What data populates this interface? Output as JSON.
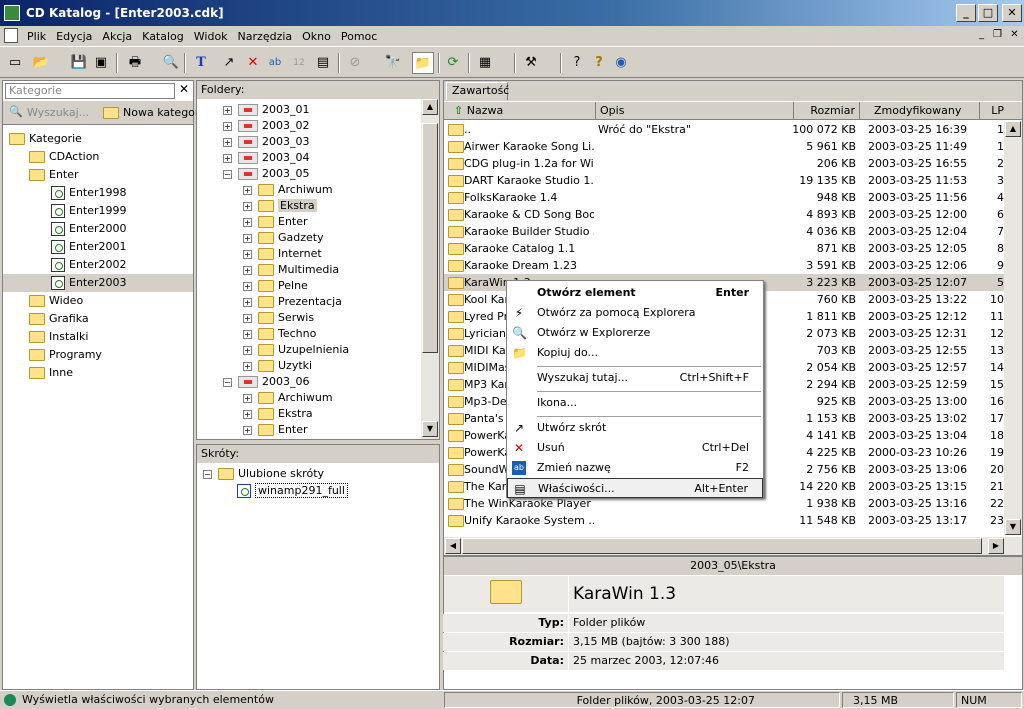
{
  "window": {
    "title": "CD Katalog - [Enter2003.cdk]",
    "min": "_",
    "max": "□",
    "close": "✕"
  },
  "menu": [
    "Plik",
    "Edycja",
    "Akcja",
    "Katalog",
    "Widok",
    "Narzędzia",
    "Okno",
    "Pomoc"
  ],
  "toolbar_icons": [
    "new-icon",
    "open-icon",
    "save-icon",
    "print-icon",
    "preview-icon",
    "text-icon",
    "delete-icon",
    "rename-icon",
    "sort-icon",
    "properties-icon",
    "find-icon",
    "folder-icon",
    "refresh-icon",
    "view-icon",
    "tools-icon",
    "help-icon",
    "globe-icon"
  ],
  "categories": {
    "search_placeholder": "Kategorie",
    "search_btn": "Wyszukaj...",
    "new_btn": "Nowa kategoria",
    "items": [
      "Kategorie",
      "CDAction",
      "Enter",
      "Enter1998",
      "Enter1999",
      "Enter2000",
      "Enter2001",
      "Enter2002",
      "Enter2003",
      "Wideo",
      "Grafika",
      "Instalki",
      "Programy",
      "Inne"
    ]
  },
  "folders": {
    "title": "Foldery:",
    "items": [
      "2003_01",
      "2003_02",
      "2003_03",
      "2003_04",
      "2003_05",
      "Archiwum",
      "Ekstra",
      "Enter",
      "Gadzety",
      "Internet",
      "Multimedia",
      "Pelne",
      "Prezentacja",
      "Serwis",
      "Techno",
      "Uzupelnienia",
      "Uzytki",
      "2003_06",
      "Archiwum",
      "Ekstra",
      "Enter"
    ]
  },
  "shortcuts": {
    "title": "Skróty:",
    "root": "Ulubione skróty",
    "item": "winamp291_full"
  },
  "content": {
    "tab": "Zawartość",
    "columns": [
      "Nazwa",
      "Opis",
      "Rozmiar",
      "Zmodyfikowany",
      "LP"
    ],
    "rows": [
      [
        "..",
        "Wróć do \"Ekstra\"",
        "100 072 KB",
        "2003-03-25 16:39",
        "1"
      ],
      [
        "Airwer Karaoke Song Li...",
        "",
        "5 961 KB",
        "2003-03-25 11:49",
        "1"
      ],
      [
        "CDG plug-in 1.2a for Wi...",
        "",
        "206 KB",
        "2003-03-25 16:55",
        "2"
      ],
      [
        "DART Karaoke Studio 1....",
        "",
        "19 135 KB",
        "2003-03-25 11:53",
        "3"
      ],
      [
        "FolksKaraoke 1.4",
        "",
        "948 KB",
        "2003-03-25 11:56",
        "4"
      ],
      [
        "Karaoke & CD Song Boo...",
        "",
        "4 893 KB",
        "2003-03-25 12:00",
        "6"
      ],
      [
        "Karaoke Builder Studio 3.0",
        "",
        "4 036 KB",
        "2003-03-25 12:04",
        "7"
      ],
      [
        "Karaoke Catalog 1.1",
        "",
        "871 KB",
        "2003-03-25 12:05",
        "8"
      ],
      [
        "Karaoke Dream 1.23",
        "",
        "3 591 KB",
        "2003-03-25 12:06",
        "9"
      ],
      [
        "KaraWin 1.3",
        "",
        "3 223 KB",
        "2003-03-25 12:07",
        "5"
      ],
      [
        "Kool Kara",
        "",
        "760 KB",
        "2003-03-25 13:22",
        "10"
      ],
      [
        "Lyred Pro",
        "",
        "1 811 KB",
        "2003-03-25 12:12",
        "11"
      ],
      [
        "Lyrician 1",
        "",
        "2 073 KB",
        "2003-03-25 12:31",
        "12"
      ],
      [
        "MIDI Kar",
        "",
        "703 KB",
        "2003-03-25 12:55",
        "13"
      ],
      [
        "MIDIMas",
        "",
        "2 054 KB",
        "2003-03-25 12:57",
        "14"
      ],
      [
        "MP3 Kara",
        "",
        "2 294 KB",
        "2003-03-25 12:59",
        "15"
      ],
      [
        "Mp3-Delu",
        "",
        "925 KB",
        "2003-03-25 13:00",
        "16"
      ],
      [
        "Panta's L",
        "",
        "1 153 KB",
        "2003-03-25 13:02",
        "17"
      ],
      [
        "PowerKa",
        "",
        "4 141 KB",
        "2003-03-25 13:04",
        "18"
      ],
      [
        "PowerKa",
        "",
        "4 225 KB",
        "2000-03-23 10:26",
        "19"
      ],
      [
        "SoundWi",
        "",
        "2 756 KB",
        "2003-03-25 13:06",
        "20"
      ],
      [
        "The Kara",
        "",
        "14 220 KB",
        "2003-03-25 13:15",
        "21"
      ],
      [
        "The WinKaraoke Player ...",
        "",
        "1 938 KB",
        "2003-03-25 13:16",
        "22"
      ],
      [
        "Unify Karaoke System ...",
        "",
        "11 548 KB",
        "2003-03-25 13:17",
        "23"
      ]
    ]
  },
  "context_menu": [
    {
      "label": "Otwórz element",
      "sc": "Enter",
      "icon": "",
      "bold": true
    },
    {
      "label": "Otwórz za pomocą Explorera",
      "sc": "",
      "icon": "⚡"
    },
    {
      "label": "Otwórz w Explorerze",
      "sc": "",
      "icon": "🔍"
    },
    {
      "label": "Kopiuj do...",
      "sc": "",
      "icon": "📁"
    },
    {
      "sep": true
    },
    {
      "label": "Wyszukaj tutaj...",
      "sc": "Ctrl+Shift+F",
      "icon": ""
    },
    {
      "sep": true
    },
    {
      "label": "Ikona...",
      "sc": "",
      "icon": ""
    },
    {
      "sep": true
    },
    {
      "label": "Utwórz skrót",
      "sc": "",
      "icon": "↗"
    },
    {
      "label": "Usuń",
      "sc": "Ctrl+Del",
      "icon": "✕"
    },
    {
      "label": "Zmień nazwę",
      "sc": "F2",
      "icon": "ab"
    },
    {
      "label": "Właściwości...",
      "sc": "Alt+Enter",
      "icon": "▤"
    }
  ],
  "details": {
    "path": "2003_05\\Ekstra",
    "name": "KaraWin 1.3",
    "type_label": "Typ:",
    "type": "Folder plików",
    "size_label": "Rozmiar:",
    "size": "3,15 MB (bajtów: 3 300 188)",
    "date_label": "Data:",
    "date": "25 marzec 2003, 12:07:46"
  },
  "status": {
    "hint": "Wyświetla właściwości wybranych elementów",
    "info": "Folder plików, 2003-03-25 12:07",
    "size": "3,15 MB",
    "mode": "NUM"
  }
}
